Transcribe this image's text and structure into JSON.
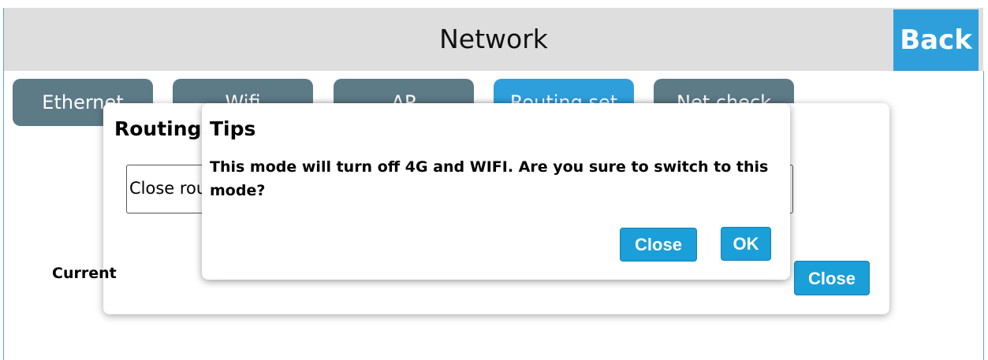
{
  "header": {
    "title": "Network",
    "back_label": "Back"
  },
  "tabs": [
    {
      "label": "Ethernet",
      "active": false
    },
    {
      "label": "Wifi",
      "active": false
    },
    {
      "label": "AP",
      "active": false
    },
    {
      "label": "Routing set",
      "active": true
    },
    {
      "label": "Net check",
      "active": false
    }
  ],
  "routing_dialog": {
    "title": "Routing",
    "select_value": "Close routing",
    "current_label": "Current",
    "close_label": "Close"
  },
  "tips_dialog": {
    "title": "Tips",
    "message": "This mode will turn off 4G and WIFI. Are you sure to switch to this mode?",
    "close_label": "Close",
    "ok_label": "OK"
  },
  "colors": {
    "accent": "#2f9fdc",
    "tab_inactive": "#5d7a87",
    "header_bg": "#dedede"
  }
}
